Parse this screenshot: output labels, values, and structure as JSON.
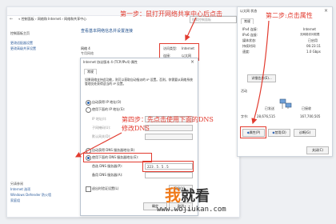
{
  "control_panel": {
    "breadcrumb": "« 控制面板 › 网络和 Internet › 网络和共享中心",
    "search_placeholder": "搜索控制面板",
    "sidebar_items": [
      "控制面板主页",
      "更改适配器设置",
      "更改高级共享设置"
    ],
    "see_also_title": "另请参阅",
    "see_also_items": [
      "Internet 选项",
      "Windows Defender 防火墙",
      "家庭组"
    ],
    "heading": "查看基本网络信息并设置连接",
    "network_name": "网络 4",
    "network_type": "专用网络",
    "access_type_label": "访问类型:",
    "access_type_value": "Internet",
    "connection_label": "连接:",
    "connection_value": "以太网"
  },
  "ipv4_dialog": {
    "title": "Internet 协议版本 4 (TCP/IPv4) 属性",
    "tab": "常规",
    "description": "如果网络支持此功能，则可以获取自动指派的 IP 设置。否则，你需要从网络系统管理员处获得适当的 IP 设置。",
    "auto_ip_label": "自动获得 IP 地址(O)",
    "manual_ip_label": "使用下面的 IP 地址(S):",
    "ip_label": "IP 地址(I):",
    "mask_label": "子网掩码(U):",
    "gateway_label": "默认网关(D):",
    "auto_dns_label": "自动获得 DNS 服务器地址(B)",
    "manual_dns_label": "使用下面的 DNS 服务器地址(E):",
    "preferred_dns_label": "首选 DNS 服务器(P):",
    "preferred_dns_value": "223 . 5 . 5 . 5",
    "alternate_dns_label": "备用 DNS 服务器(A):",
    "validate_label": "退出时验证设置(L)",
    "advanced_button": "高级(V)...",
    "ok_button": "确定",
    "cancel_button": "取消"
  },
  "status_dialog": {
    "title": "以太网 状态",
    "tab": "常规",
    "rows": [
      {
        "label": "IPv4 连接:",
        "value": "Internet"
      },
      {
        "label": "IPv6 连接:",
        "value": "无网络访问权限"
      },
      {
        "label": "媒体状态:",
        "value": "已启用"
      },
      {
        "label": "持续时间:",
        "value": "06:23:11"
      },
      {
        "label": "速度:",
        "value": "1.0 Gbps"
      }
    ],
    "details_button": "详细信息(E)...",
    "activity_label": "活动",
    "sent_label": "已发送",
    "received_label": "已接收",
    "bytes_label": "字节:",
    "sent_bytes": "28,676,515",
    "received_bytes": "167,700,505",
    "properties_button": "属性(P)",
    "disable_button": "禁用(D)",
    "diagnose_button": "诊断(G)",
    "close_button": "关闭(C)"
  },
  "annotations": {
    "step1": "第一步：鼠打开网络共享中心后点击",
    "step2": "第二步:点击属性",
    "step4a": "第四步：先点击使用下面的DNS",
    "step4b": "修改DNS"
  },
  "watermark": {
    "logo_char": "我",
    "logo_text": "就看",
    "url": "www.wojiukan.com"
  },
  "colors": {
    "annotation_red": "#e23b2f",
    "link_blue": "#1f5fb0",
    "logo_orange": "#f07a1a"
  }
}
